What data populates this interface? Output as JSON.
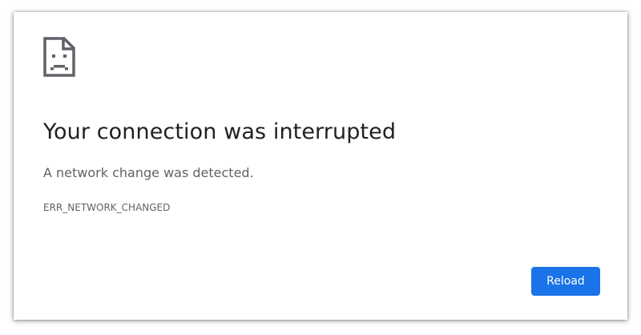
{
  "error_page": {
    "icon": "sad-page-icon",
    "title": "Your connection was interrupted",
    "message": "A network change was detected.",
    "error_code": "ERR_NETWORK_CHANGED",
    "reload_label": "Reload"
  },
  "colors": {
    "accent": "#1a73e8",
    "title_text": "#202124",
    "secondary_text": "#5f6368"
  }
}
